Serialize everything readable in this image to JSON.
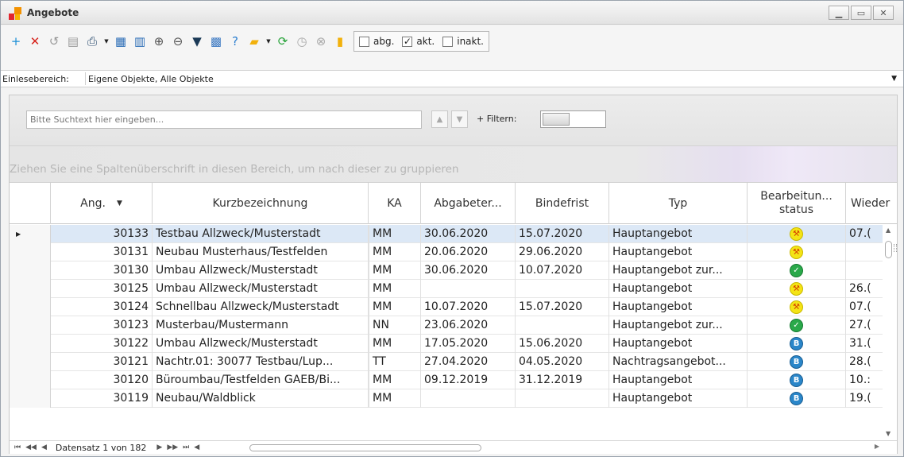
{
  "window": {
    "title": "Angebote",
    "controls": [
      "minimize-icon",
      "maximize-icon",
      "close-icon"
    ]
  },
  "toolbar": {
    "icons": [
      {
        "name": "add-icon",
        "glyph": "+",
        "color": "#1c8fd6"
      },
      {
        "name": "delete-icon",
        "glyph": "✕",
        "color": "#d6241d"
      },
      {
        "name": "undo-icon",
        "glyph": "↺",
        "color": "#9a9a9a"
      },
      {
        "name": "save-icon",
        "glyph": "▤",
        "color": "#9a9a9a"
      },
      {
        "name": "print-icon",
        "glyph": "⎙",
        "color": "#2b4c6f"
      },
      {
        "name": "view-icon",
        "glyph": "▦",
        "color": "#2d6eb7"
      },
      {
        "name": "columns-icon",
        "glyph": "▥",
        "color": "#2d6eb7"
      },
      {
        "name": "zoom-in-icon",
        "glyph": "⊕",
        "color": "#555555"
      },
      {
        "name": "zoom-out-icon",
        "glyph": "⊖",
        "color": "#555555"
      },
      {
        "name": "filter-icon",
        "glyph": "▼",
        "color": "#1b3a57"
      },
      {
        "name": "layout-icon",
        "glyph": "▩",
        "color": "#3a78c2"
      },
      {
        "name": "help-icon",
        "glyph": "?",
        "color": "#2d7fd0"
      },
      {
        "name": "folder-icon",
        "glyph": "▰",
        "color": "#f2b10c"
      },
      {
        "name": "refresh-icon",
        "glyph": "⟳",
        "color": "#2aa43c"
      },
      {
        "name": "clock-icon",
        "glyph": "◷",
        "color": "#aaaaaa"
      },
      {
        "name": "cancel-icon",
        "glyph": "⊗",
        "color": "#aaaaaa"
      },
      {
        "name": "clipboard-add-icon",
        "glyph": "▮",
        "color": "#f2b10c"
      }
    ],
    "checkboxes": [
      {
        "label": "abg.",
        "checked": false
      },
      {
        "label": "akt.",
        "checked": true
      },
      {
        "label": "inakt.",
        "checked": false
      }
    ]
  },
  "range": {
    "label": "Einlesebereich:",
    "value": "Eigene Objekte, Alle Objekte"
  },
  "search": {
    "placeholder": "Bitte Suchtext hier eingeben...",
    "filter_label": "+ Filtern:"
  },
  "group_hint": "Ziehen Sie eine Spaltenüberschrift in diesen Bereich, um nach dieser zu gruppieren",
  "grid": {
    "columns": [
      "Ang.",
      "Kurzbezeichnung",
      "KA",
      "Abgabeter...",
      "Bindefrist",
      "Typ",
      "Bearbeitun...\nstatus",
      "Wieder"
    ],
    "status_colors": {
      "wrench": "#f4e415",
      "check": "#2aa94a",
      "doc": "#2a86c9"
    },
    "rows": [
      {
        "ang": "30133",
        "kurz": "Testbau Allzweck/Musterstadt",
        "ka": "MM",
        "abgabe": "30.06.2020",
        "binde": "15.07.2020",
        "typ": "Hauptangebot",
        "status": "wrench",
        "wieder": "07.("
      },
      {
        "ang": "30131",
        "kurz": "Neubau Musterhaus/Testfelden",
        "ka": "MM",
        "abgabe": "20.06.2020",
        "binde": "29.06.2020",
        "typ": "Hauptangebot",
        "status": "wrench",
        "wieder": ""
      },
      {
        "ang": "30130",
        "kurz": "Umbau Allzweck/Musterstadt",
        "ka": "MM",
        "abgabe": "30.06.2020",
        "binde": "10.07.2020",
        "typ": "Hauptangebot zur...",
        "status": "check",
        "wieder": ""
      },
      {
        "ang": "30125",
        "kurz": "Umbau Allzweck/Musterstadt",
        "ka": "MM",
        "abgabe": "",
        "binde": "",
        "typ": "Hauptangebot",
        "status": "wrench",
        "wieder": "26.("
      },
      {
        "ang": "30124",
        "kurz": "Schnellbau Allzweck/Musterstadt",
        "ka": "MM",
        "abgabe": "10.07.2020",
        "binde": "15.07.2020",
        "typ": "Hauptangebot",
        "status": "wrench",
        "wieder": "07.("
      },
      {
        "ang": "30123",
        "kurz": "Musterbau/Mustermann",
        "ka": "NN",
        "abgabe": "23.06.2020",
        "binde": "",
        "typ": "Hauptangebot zur...",
        "status": "check",
        "wieder": "27.("
      },
      {
        "ang": "30122",
        "kurz": "Umbau Allzweck/Musterstadt",
        "ka": "MM",
        "abgabe": "17.05.2020",
        "binde": "15.06.2020",
        "typ": "Hauptangebot",
        "status": "doc",
        "wieder": "31.("
      },
      {
        "ang": "30121",
        "kurz": "Nachtr.01: 30077 Testbau/Lup...",
        "ka": "TT",
        "abgabe": "27.04.2020",
        "binde": "04.05.2020",
        "typ": "Nachtragsangebot...",
        "status": "doc",
        "wieder": "28.("
      },
      {
        "ang": "30120",
        "kurz": "Büroumbau/Testfelden GAEB/Bi...",
        "ka": "MM",
        "abgabe": "09.12.2019",
        "binde": "31.12.2019",
        "typ": "Hauptangebot",
        "status": "doc",
        "wieder": "10.:"
      },
      {
        "ang": "30119",
        "kurz": "Neubau/Waldblick",
        "ka": "MM",
        "abgabe": "",
        "binde": "",
        "typ": "Hauptangebot",
        "status": "doc",
        "wieder": "19.("
      }
    ]
  },
  "footer": {
    "record_text": "Datensatz 1 von 182"
  }
}
